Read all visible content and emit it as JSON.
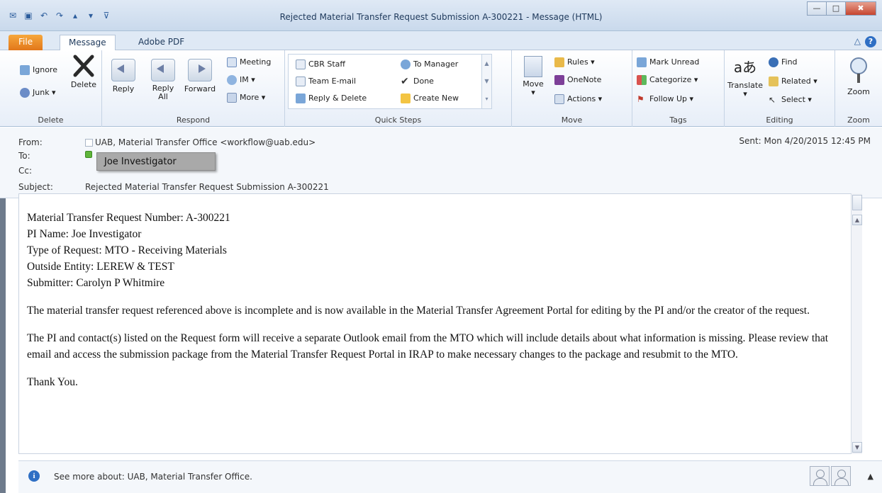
{
  "window": {
    "title": "Rejected Material Transfer Request Submission A-300221  -  Message (HTML)",
    "min_glyph": "—",
    "max_glyph": "□",
    "close_glyph": "✖"
  },
  "tabs": {
    "file": "File",
    "message": "Message",
    "pdf": "Adobe PDF",
    "collapse_glyph": "△",
    "help_glyph": "?"
  },
  "ribbon": {
    "delete": {
      "label": "Delete",
      "ignore": "Ignore",
      "junk": "Junk ▾",
      "delete_btn": "Delete"
    },
    "respond": {
      "label": "Respond",
      "reply": "Reply",
      "reply_all_1": "Reply",
      "reply_all_2": "All",
      "forward": "Forward",
      "meeting": "Meeting",
      "im": "IM ▾",
      "more": "More ▾"
    },
    "quick_steps": {
      "label": "Quick Steps",
      "cbr_staff": "CBR Staff",
      "team_email": "Team E-mail",
      "reply_delete": "Reply & Delete",
      "to_manager": "To Manager",
      "done": "Done",
      "create_new": "Create New",
      "scroll_up": "▲",
      "scroll_down": "▼",
      "scroll_more": "▾"
    },
    "move": {
      "label": "Move",
      "move": "Move",
      "move_arrow": "▾",
      "rules": "Rules ▾",
      "onenote": "OneNote",
      "actions": "Actions ▾"
    },
    "tags": {
      "label": "Tags",
      "mark_unread": "Mark Unread",
      "categorize": "Categorize ▾",
      "follow_up": "Follow Up ▾"
    },
    "editing": {
      "label": "Editing",
      "translate": "Translate",
      "translate_arrow": "▾",
      "find": "Find",
      "related": "Related ▾",
      "select": "Select ▾",
      "translate_glyph": "aあ"
    },
    "zoom": {
      "label": "Zoom",
      "zoom": "Zoom"
    }
  },
  "header": {
    "from_label": "From:",
    "from_value": "UAB, Material Transfer Office <workflow@uab.edu>",
    "to_label": "To:",
    "cc_label": "Cc:",
    "subject_label": "Subject:",
    "subject_value": "Rejected Material Transfer Request Submission A-300221",
    "sent": "Sent:   Mon 4/20/2015 12:45 PM",
    "tooltip": "Joe Investigator"
  },
  "body": {
    "line1": "Material Transfer Request Number: A-300221",
    "line2": "PI Name: Joe Investigator",
    "line3": "Type of Request: MTO - Receiving Materials",
    "line4": "Outside Entity: LEREW & TEST",
    "line5": "Submitter: Carolyn P Whitmire",
    "para1": "The material transfer request referenced above is incomplete and is now available in the Material Transfer Agreement Portal for editing by the PI and/or the creator of the request.",
    "para2": "The PI and contact(s) listed on the Request form will receive a separate Outlook email from the MTO which will include details about what information is missing. Please review that email and access the submission package from the Material Transfer Request Portal in IRAP to make necessary changes to the package and resubmit to the MTO.",
    "thanks": "Thank You.",
    "scroll_up": "▲",
    "scroll_down": "▼"
  },
  "people_pane": {
    "text": "See more about: UAB, Material Transfer Office.",
    "info_glyph": "i",
    "expand_glyph": "▲"
  }
}
